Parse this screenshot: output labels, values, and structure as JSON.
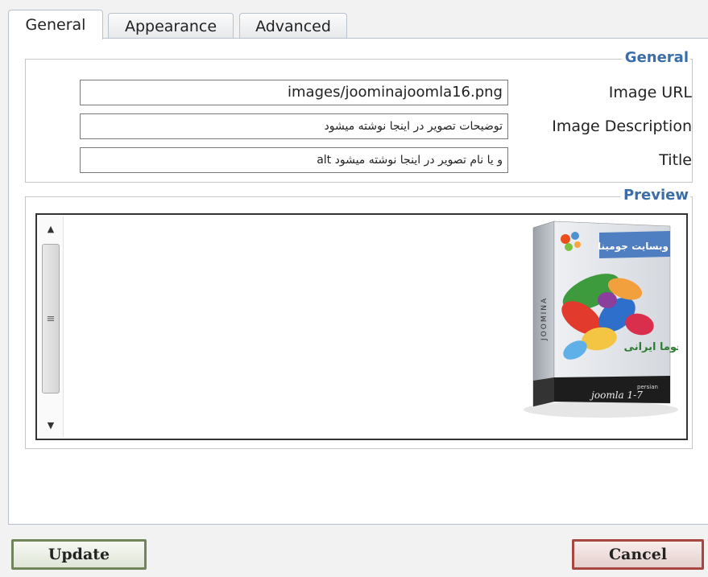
{
  "tabs": [
    {
      "label": "General",
      "active": true
    },
    {
      "label": "Appearance",
      "active": false
    },
    {
      "label": "Advanced",
      "active": false
    }
  ],
  "general": {
    "legend": "General",
    "fields": [
      {
        "label": "Image URL",
        "value": "images/joominajoomla16.png"
      },
      {
        "label": "Image Description",
        "value": "توضیحات تصویر در اینجا نوشته میشود"
      },
      {
        "label": "Title",
        "value": "alt و یا نام تصویر در اینجا نوشته میشود"
      }
    ]
  },
  "preview": {
    "legend": "Preview",
    "box_banner": "وبسایت جومینا",
    "box_brand": "JOOMINA",
    "box_subtitle": "جوما ایرانی",
    "box_persian_label": "persian",
    "box_version": "joomla 1-7"
  },
  "buttons": {
    "update": "Update",
    "cancel": "Cancel"
  }
}
